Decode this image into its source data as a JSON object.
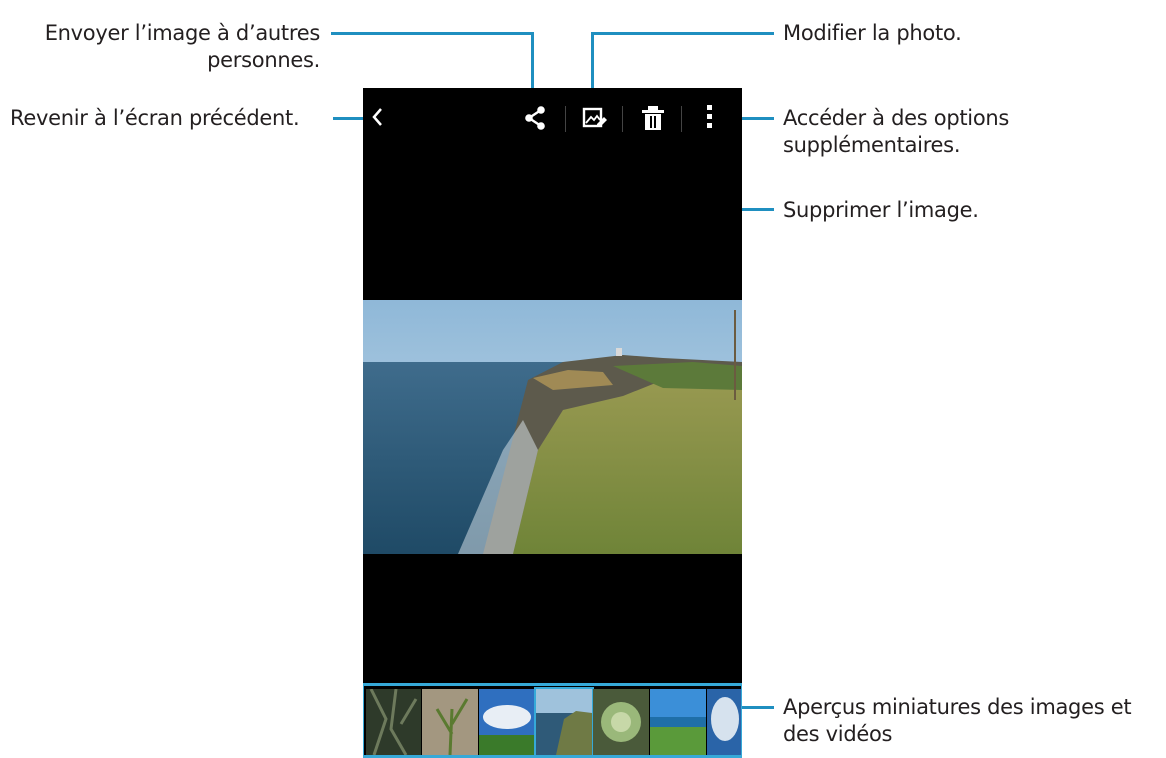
{
  "annotations": {
    "share": "Envoyer l’image à d’autres personnes.",
    "edit": "Modifier la photo.",
    "back": "Revenir à l’écran précédent.",
    "more": "Accéder à des options supplémentaires.",
    "delete": "Supprimer l’image.",
    "thumbnails": "Aperçus miniatures des images et des vidéos"
  },
  "share_lines": [
    "Envoyer l’image à d’autres",
    "personnes."
  ],
  "more_lines": [
    "Accéder à des options",
    "supplémentaires."
  ],
  "thumb_lines": [
    "Aperçus miniatures des images et",
    "des vidéos"
  ],
  "toolbar": {
    "icons": [
      "back-icon",
      "share-icon",
      "edit-photo-icon",
      "delete-icon",
      "more-options-icon"
    ]
  },
  "colors": {
    "callout_line": "#1f8fc0",
    "selected_thumb": "#36a9d8",
    "screen_bg": "#000000"
  }
}
